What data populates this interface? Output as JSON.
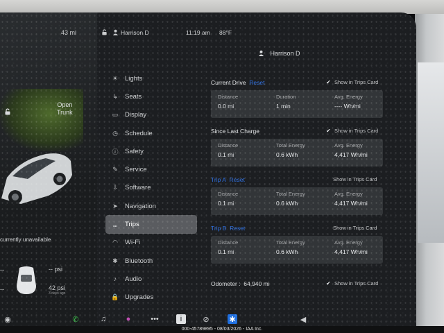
{
  "status_bar": {
    "range": "43 mi",
    "user_name": "Harrison D",
    "time": "11:19 am",
    "temperature": "88°F"
  },
  "car_panel": {
    "trunk_label": "Open",
    "trunk_sub": "Trunk",
    "tire_status": "currently unavailable",
    "tires": [
      {
        "value": "-- psi",
        "sub": ""
      },
      {
        "value": "42 psi",
        "sub": "3 days ago"
      }
    ],
    "side_value_left": "--",
    "side_value_left2": "--"
  },
  "menu": {
    "items": [
      {
        "label": "Lights",
        "icon": "lights-icon",
        "glyph": "☀"
      },
      {
        "label": "Seats",
        "icon": "seat-icon",
        "glyph": "↳"
      },
      {
        "label": "Display",
        "icon": "display-icon",
        "glyph": "▭"
      },
      {
        "label": "Schedule",
        "icon": "schedule-icon",
        "glyph": "◷"
      },
      {
        "label": "Safety",
        "icon": "safety-icon",
        "glyph": "ⓘ"
      },
      {
        "label": "Service",
        "icon": "wrench-icon",
        "glyph": "✎"
      },
      {
        "label": "Software",
        "icon": "download-icon",
        "glyph": "⇩"
      },
      {
        "label": "Navigation",
        "icon": "navigation-icon",
        "glyph": "➤"
      },
      {
        "label": "Trips",
        "icon": "trips-icon",
        "glyph": "⑉"
      },
      {
        "label": "Wi-Fi",
        "icon": "wifi-icon",
        "glyph": "◠"
      },
      {
        "label": "Bluetooth",
        "icon": "bluetooth-icon",
        "glyph": "✱"
      },
      {
        "label": "Audio",
        "icon": "audio-icon",
        "glyph": "♪"
      },
      {
        "label": "Upgrades",
        "icon": "upgrades-icon",
        "glyph": "🔒"
      }
    ],
    "active_index": 8
  },
  "header": {
    "user_name": "Harrison D"
  },
  "trips": {
    "current_drive": {
      "title": "Current Drive",
      "link": "Reset",
      "show_in_trips_card": "Show in Trips Card",
      "checked": true,
      "stats": [
        {
          "label": "Distance",
          "value": "0.0 mi"
        },
        {
          "label": "Duration",
          "value": "1 min"
        },
        {
          "label": "Avg. Energy",
          "value": "---- Wh/mi"
        }
      ]
    },
    "since_last_charge": {
      "title": "Since Last Charge",
      "show_in_trips_card": "Show in Trips Card",
      "checked": true,
      "stats": [
        {
          "label": "Distance",
          "value": "0.1 mi"
        },
        {
          "label": "Total Energy",
          "value": "0.6 kWh"
        },
        {
          "label": "Avg. Energy",
          "value": "4,417 Wh/mi"
        }
      ]
    },
    "trip_a": {
      "title": "Trip A",
      "link": "Reset",
      "show_in_trips_card": "Show in Trips Card",
      "checked": false,
      "stats": [
        {
          "label": "Distance",
          "value": "0.1 mi"
        },
        {
          "label": "Total Energy",
          "value": "0.6 kWh"
        },
        {
          "label": "Avg. Energy",
          "value": "4,417 Wh/mi"
        }
      ]
    },
    "trip_b": {
      "title": "Trip B",
      "link": "Reset",
      "show_in_trips_card": "Show in Trips Card",
      "checked": false,
      "stats": [
        {
          "label": "Distance",
          "value": "0.1 mi"
        },
        {
          "label": "Total Energy",
          "value": "0.6 kWh"
        },
        {
          "label": "Avg. Energy",
          "value": "4,417 Wh/mi"
        }
      ]
    },
    "odometer": {
      "label": "Odometer :",
      "value": "64,940 mi",
      "show_in_trips_card": "Show in Trips Card",
      "checked": true
    }
  },
  "taskbar": {
    "icons": [
      "phone-icon",
      "music-icon",
      "camera-icon",
      "more-icon",
      "info-icon",
      "no-entry-icon",
      "bluetooth-icon",
      "volume-icon"
    ]
  },
  "watermark": "000-45789895 - 08/03/2026 - IAA Inc.",
  "colors": {
    "accent": "#2e6fe0",
    "phone": "#3bbf4a",
    "bluetooth_tile": "#1f6fe0",
    "active_menu": "#5a5c60"
  }
}
